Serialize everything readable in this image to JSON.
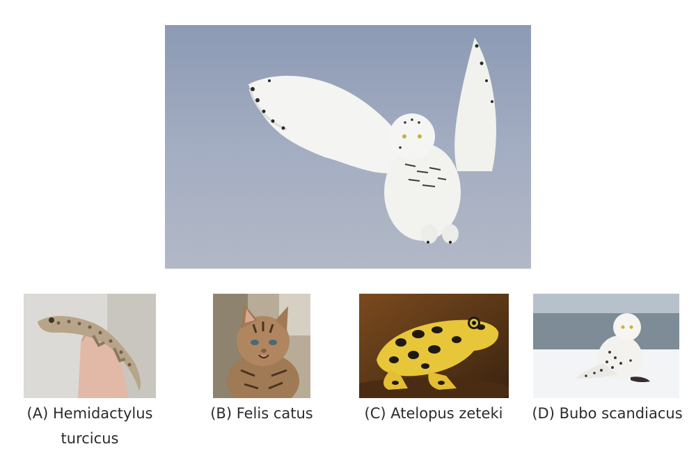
{
  "options": [
    {
      "letter": "A",
      "label": "(A) Hemidactylus turcicus"
    },
    {
      "letter": "B",
      "label": "(B) Felis catus"
    },
    {
      "letter": "C",
      "label": "(C) Atelopus zeteki"
    },
    {
      "letter": "D",
      "label": "(D) Bubo scandiacus"
    }
  ],
  "colors": {
    "sky": "#9aa6bc",
    "owl_white": "#f4f4f2",
    "frog_yellow": "#e8c63a",
    "frog_black": "#1e1a12",
    "kitten_brown": "#a07a55",
    "gecko_tan": "#b8a488",
    "snow": "#f2f4f6"
  },
  "icons": {
    "main": "snowy-owl-flying-photo",
    "a": "gecko-on-finger-photo",
    "b": "kitten-photo",
    "c": "golden-frog-photo",
    "d": "snowy-owl-sitting-photo"
  }
}
